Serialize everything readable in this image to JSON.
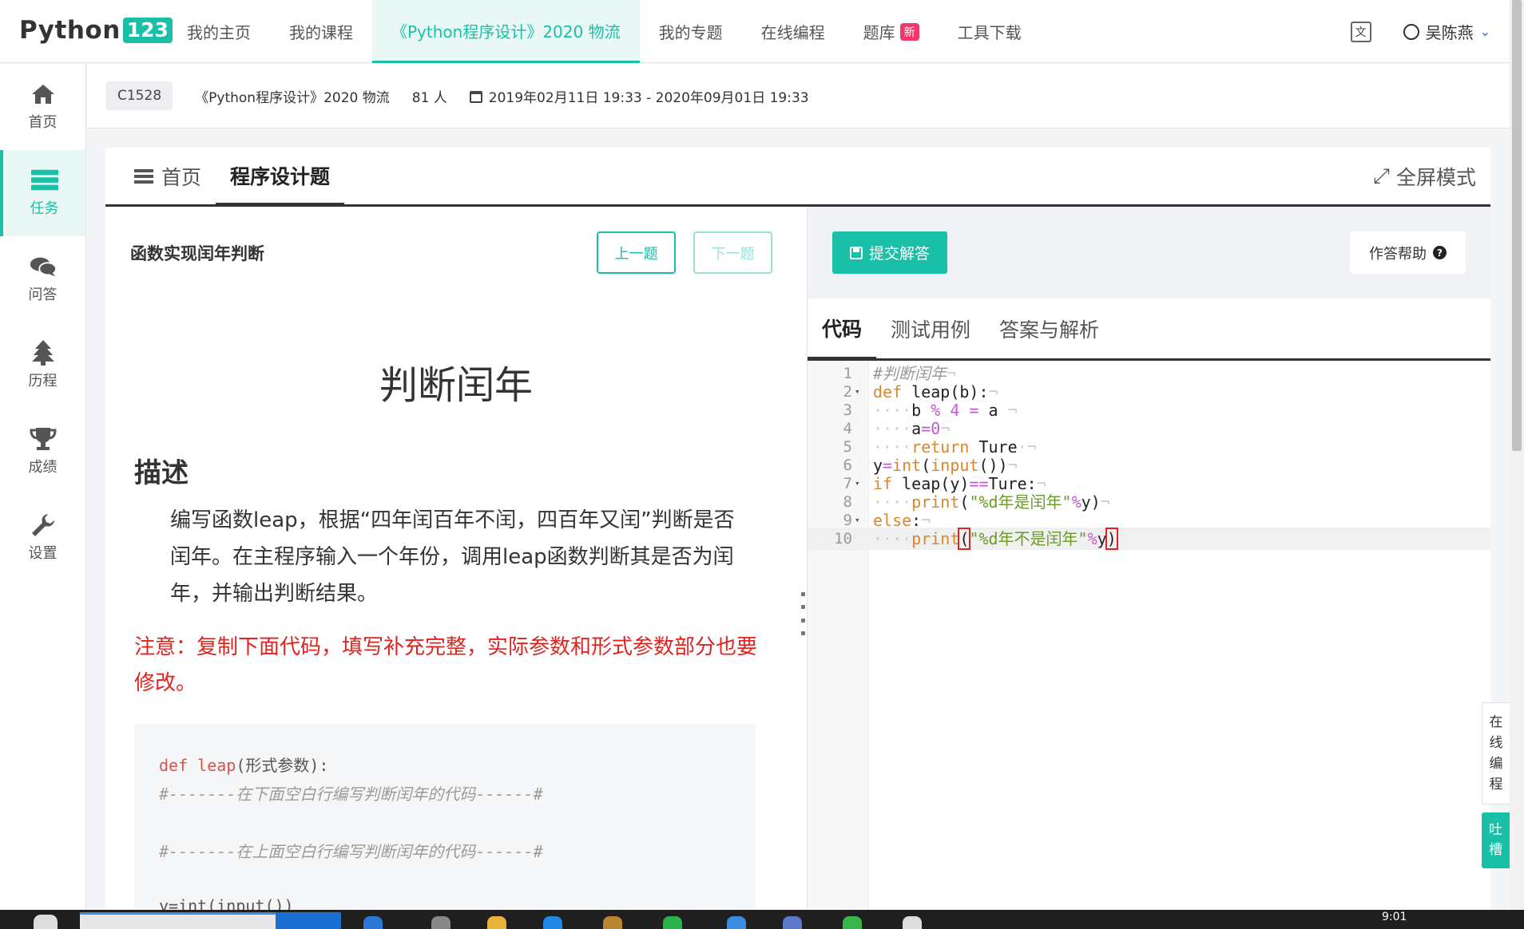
{
  "nav": {
    "logo_text": "Python",
    "logo_badge": "123",
    "items": [
      {
        "label": "我的主页"
      },
      {
        "label": "我的课程"
      },
      {
        "label": "《Python程序设计》2020 物流"
      },
      {
        "label": "我的专题"
      },
      {
        "label": "在线编程"
      },
      {
        "label": "题库",
        "badge": "新"
      },
      {
        "label": "工具下载"
      }
    ],
    "active_index": 2,
    "user_name": "吴陈燕",
    "colors": {
      "accent": "#19bfa6",
      "badge": "#f0386b"
    }
  },
  "sidebar": {
    "items": [
      {
        "label": "首页",
        "icon": "home-icon"
      },
      {
        "label": "任务",
        "icon": "tasks-icon"
      },
      {
        "label": "问答",
        "icon": "chat-icon"
      },
      {
        "label": "历程",
        "icon": "tree-icon"
      },
      {
        "label": "成绩",
        "icon": "trophy-icon"
      },
      {
        "label": "设置",
        "icon": "wrench-icon"
      }
    ],
    "active_index": 1
  },
  "infobar": {
    "course_code": "C1528",
    "course_name": "《Python程序设计》2020 物流",
    "members": "81 人",
    "date_range": "2019年02月11日 19:33 - 2020年09月01日 19:33"
  },
  "card": {
    "tabs": [
      "首页",
      "程序设计题"
    ],
    "fullscreen_label": "全屏模式"
  },
  "question": {
    "title": "函数实现闰年判断",
    "prev_label": "上一题",
    "next_label": "下一题",
    "heading": "判断闰年",
    "desc_heading": "描述",
    "description": "编写函数leap，根据“四年闰百年不闰，四百年又闰”判断是否闰年。在主程序输入一个年份，调用leap函数判断其是否为闰年，并输出判断结果。",
    "note": "注意：复制下面代码，填写补充完整，实际参数和形式参数部分也要修改。",
    "code_lines": [
      "def leap(形式参数):",
      "#-------在下面空白行编写判断闰年的代码------#",
      "",
      "#-------在上面空白行编写判断闰年的代码------#",
      "",
      "y=int(input())"
    ]
  },
  "editor_panel": {
    "submit_label": "提交解答",
    "help_label": "作答帮助",
    "tabs": [
      "代码",
      "测试用例",
      "答案与解析"
    ]
  },
  "editor": {
    "line_numbers": [
      "1",
      "2",
      "3",
      "4",
      "5",
      "6",
      "7",
      "8",
      "9",
      "10"
    ],
    "current_line": 10
  },
  "float": {
    "online_label": [
      "在",
      "线",
      "编",
      "程"
    ],
    "tucao_label": [
      "吐",
      "槽"
    ]
  },
  "taskbar": {
    "time": "9:01"
  }
}
